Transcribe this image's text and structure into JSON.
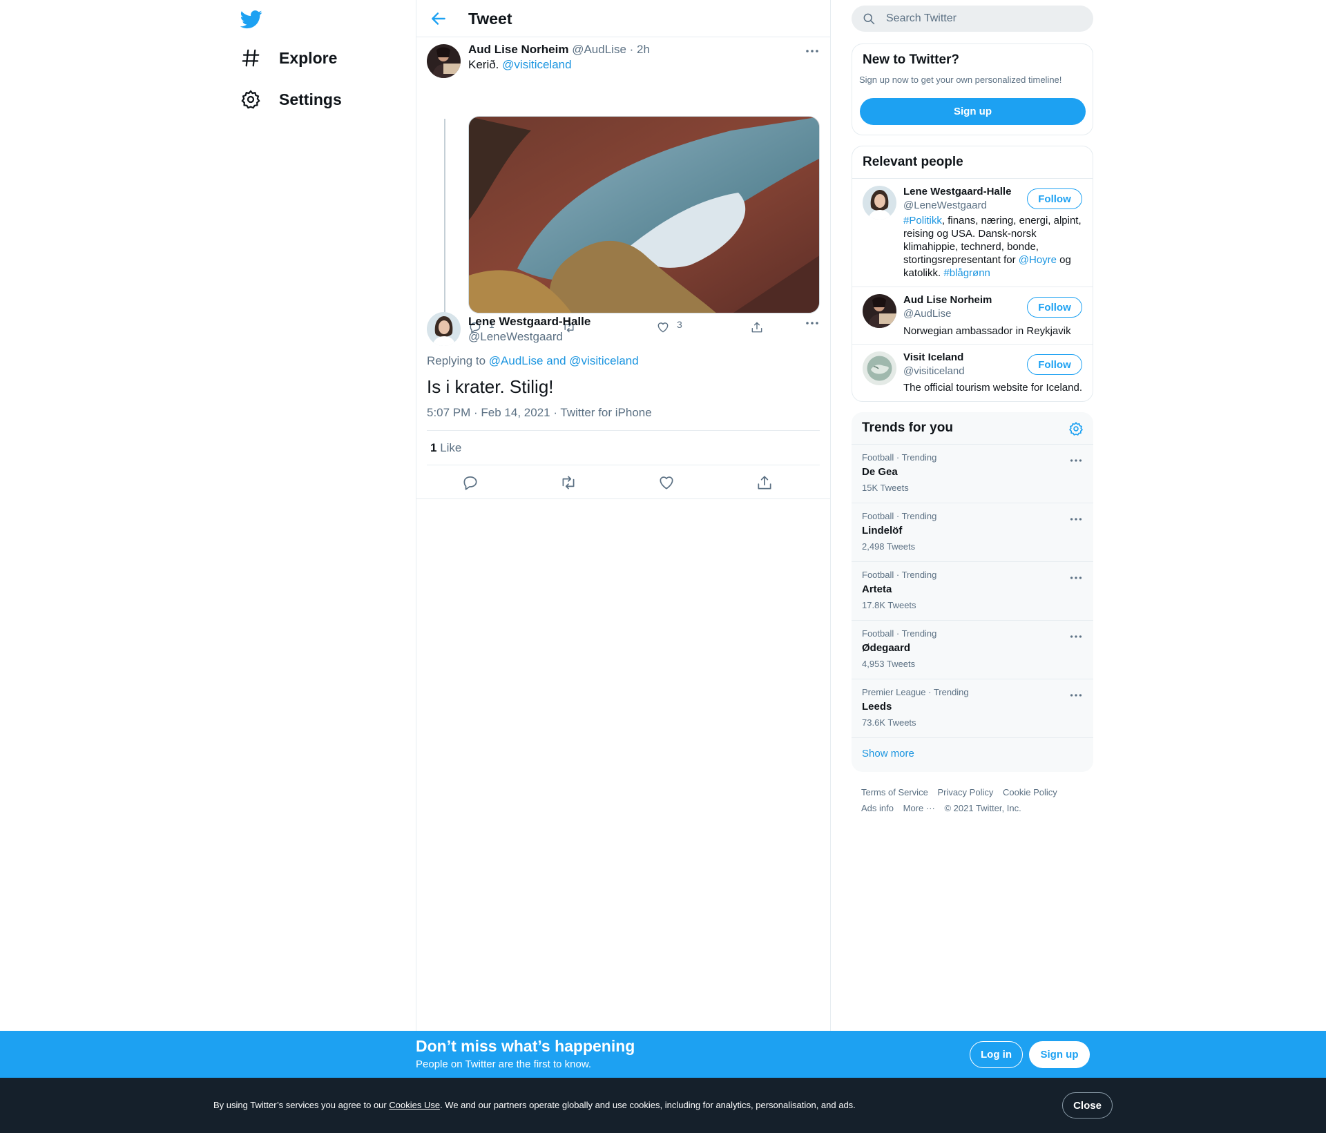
{
  "nav": {
    "items": [
      {
        "label": "Explore",
        "icon": "hashtag-icon"
      },
      {
        "label": "Settings",
        "icon": "gear-icon"
      }
    ]
  },
  "header": {
    "title": "Tweet"
  },
  "tweet1": {
    "name": "Aud Lise Norheim",
    "handle": "@AudLise",
    "time": "· 2h",
    "text": "Kerið.",
    "mention": "@visiticeland",
    "replies": "1",
    "likes": "3"
  },
  "tweet2": {
    "name": "Lene Westgaard-Halle",
    "handle": "@LeneWestgaard",
    "replying_prefix": "Replying to",
    "replying_to": "@AudLise and @visiticeland",
    "text": "Is i krater. Stilig!",
    "meta": "5:07 PM · Feb 14, 2021 · Twitter for iPhone",
    "like_count": "1",
    "like_label": "Like"
  },
  "search": {
    "placeholder": "Search Twitter"
  },
  "new_to_twitter": {
    "title": "New to Twitter?",
    "subtitle": "Sign up now to get your own personalized timeline!",
    "button": "Sign up"
  },
  "relevant": {
    "title": "Relevant people",
    "follow_label": "Follow",
    "people": [
      {
        "name": "Lene Westgaard-Halle",
        "handle": "@LeneWestgaard",
        "bio_parts": [
          "#Politikk",
          ", finans, næring, energi, alpint, reising og USA. Dansk-norsk klimahippie, technerd, bonde, stortingsrepresentant for ",
          "@Hoyre",
          " og katolikk. ",
          "#blågrønn"
        ]
      },
      {
        "name": "Aud Lise Norheim",
        "handle": "@AudLise",
        "bio": "Norwegian ambassador in Reykjavik"
      },
      {
        "name": "Visit Iceland",
        "handle": "@visiticeland",
        "bio": "The official tourism website for Iceland."
      }
    ]
  },
  "trends": {
    "title": "Trends for you",
    "items": [
      {
        "meta": "Football · Trending",
        "name": "De Gea",
        "count": "15K Tweets"
      },
      {
        "meta": "Football · Trending",
        "name": "Lindelöf",
        "count": "2,498 Tweets"
      },
      {
        "meta": "Football · Trending",
        "name": "Arteta",
        "count": "17.8K Tweets"
      },
      {
        "meta": "Football · Trending",
        "name": "Ødegaard",
        "count": "4,953 Tweets"
      },
      {
        "meta": "Premier League · Trending",
        "name": "Leeds",
        "count": "73.6K Tweets"
      }
    ],
    "show_more": "Show more"
  },
  "footer": {
    "links": [
      "Terms of Service",
      "Privacy Policy",
      "Cookie Policy",
      "Ads info",
      "More ···",
      "© 2021 Twitter, Inc."
    ]
  },
  "banner": {
    "title": "Don’t miss what’s happening",
    "subtitle": "People on Twitter are the first to know.",
    "login": "Log in",
    "signup": "Sign up"
  },
  "cookie": {
    "prefix": "By using Twitter’s services you agree to our ",
    "link": "Cookies Use",
    "suffix": ". We and our partners operate globally and use cookies, including for analytics, personalisation, and ads.",
    "close": "Close"
  },
  "colors": {
    "accent": "#1da1f2",
    "link": "#1b95e0",
    "banner": "#1da1f2",
    "cookie_bg": "#15202b"
  }
}
